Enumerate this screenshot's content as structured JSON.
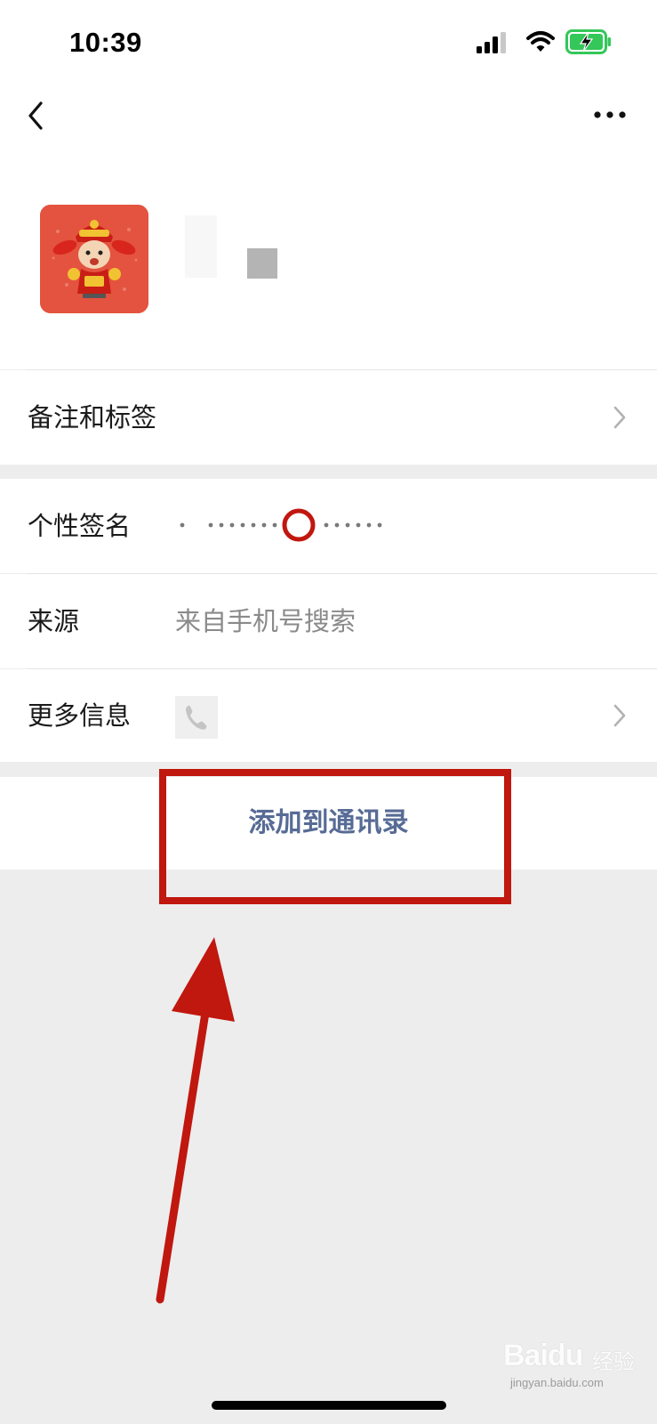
{
  "status_bar": {
    "time": "10:39",
    "icons": [
      "signal-icon",
      "wifi-icon",
      "battery-charging-icon"
    ]
  },
  "nav": {
    "back_icon": "back-chevron-icon",
    "more_icon": "more-dots-icon"
  },
  "profile": {
    "avatar_icon": "avatar-image"
  },
  "rows": {
    "remark": {
      "label": "备注和标签"
    },
    "signature": {
      "label": "个性签名"
    },
    "source": {
      "label": "来源",
      "value": "来自手机号搜索"
    },
    "more_info": {
      "label": "更多信息",
      "icon": "phone-icon"
    }
  },
  "action": {
    "add_to_contacts": "添加到通讯录"
  },
  "annotation": {
    "color": "#c0170f"
  },
  "watermark": {
    "logo": "Baidu",
    "cn": "经验",
    "url": "jingyan.baidu.com"
  },
  "colors": {
    "link_blue": "#576b95",
    "page_bg": "#ededed",
    "card_bg": "#ffffff",
    "avatar_bg": "#e4533f"
  }
}
